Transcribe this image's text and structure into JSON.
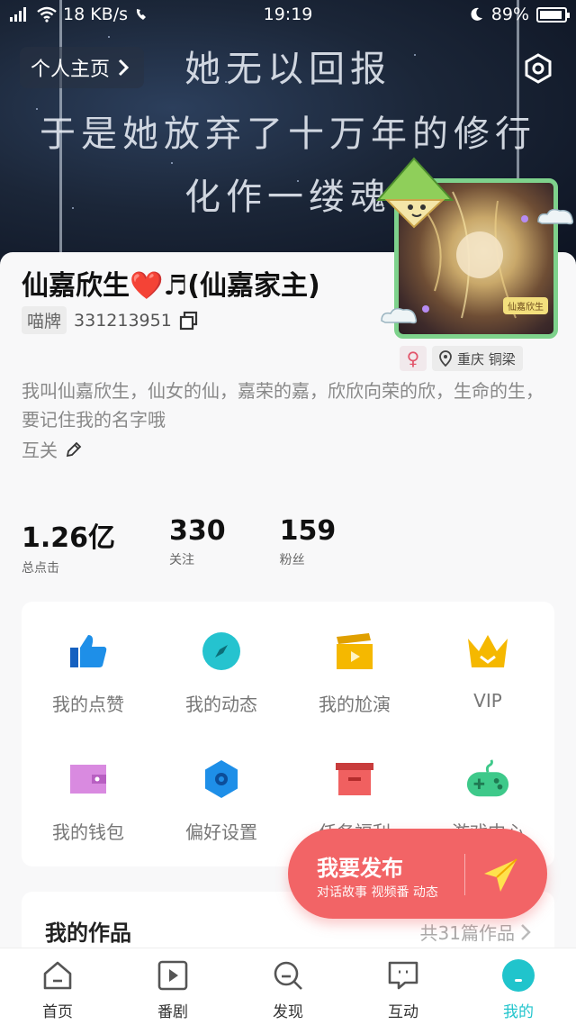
{
  "status_bar": {
    "network": "18 KB/s",
    "time": "19:19",
    "battery": "89%"
  },
  "header": {
    "home_link": "个人主页",
    "poem_lines": [
      "她无以回报",
      "于是她放弃了十万年的修行",
      "化作一缕魂"
    ]
  },
  "profile": {
    "name": "仙嘉欣生❤️♬(仙嘉家主)",
    "id_tag": "喵牌",
    "id_number": "331213951",
    "avatar_tag": "仙嘉欣生",
    "gender_symbol": "♀",
    "location": "重庆 铜梁",
    "bio": "我叫仙嘉欣生，仙女的仙，嘉荣的嘉，欣欣向荣的欣，生命的生，要记住我的名字哦",
    "relation": "互关"
  },
  "stats": [
    {
      "value": "1.26亿",
      "label": "总点击"
    },
    {
      "value": "330",
      "label": "关注"
    },
    {
      "value": "159",
      "label": "粉丝"
    }
  ],
  "grid": [
    {
      "label": "我的点赞",
      "icon": "thumbs-up-icon",
      "color": "#1e8fe8"
    },
    {
      "label": "我的动态",
      "icon": "compass-icon",
      "color": "#25c3cf"
    },
    {
      "label": "我的尬演",
      "icon": "clapperboard-icon",
      "color": "#f5b800"
    },
    {
      "label": "VIP",
      "icon": "crown-icon",
      "color": "#f5b800"
    },
    {
      "label": "我的钱包",
      "icon": "wallet-icon",
      "color": "#d98ae0"
    },
    {
      "label": "偏好设置",
      "icon": "hexagon-gear-icon",
      "color": "#1e8fe8"
    },
    {
      "label": "任务福利",
      "icon": "gift-box-icon",
      "color": "#f06060"
    },
    {
      "label": "游戏中心",
      "icon": "gamepad-icon",
      "color": "#3ec98a"
    }
  ],
  "works": {
    "title": "我的作品",
    "count": "共31篇作品"
  },
  "publish": {
    "title": "我要发布",
    "subtitle": "对话故事 视频番 动态"
  },
  "nav": [
    {
      "label": "首页",
      "icon": "home-icon"
    },
    {
      "label": "番剧",
      "icon": "play-box-icon"
    },
    {
      "label": "发现",
      "icon": "search-discover-icon"
    },
    {
      "label": "互动",
      "icon": "chat-bubble-icon"
    },
    {
      "label": "我的",
      "icon": "me-icon",
      "active": true
    }
  ]
}
